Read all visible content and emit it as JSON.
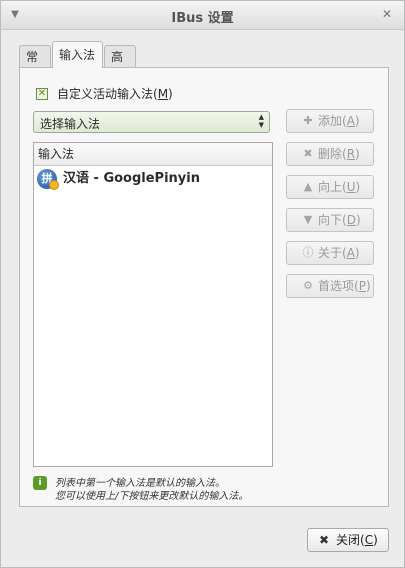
{
  "window": {
    "title": "IBus 设置",
    "menu_icon": "chevron-down-icon",
    "close_icon": "close-icon"
  },
  "tabs": [
    {
      "label": "常规",
      "active": false
    },
    {
      "label": "输入法",
      "active": true
    },
    {
      "label": "高级",
      "active": false
    }
  ],
  "custom_active": {
    "label_pre": "自定义活动输入法(",
    "mnemonic": "M",
    "label_post": ")",
    "checked": true
  },
  "selector": {
    "value": "选择输入法"
  },
  "engines": {
    "header": "输入法",
    "items": [
      {
        "name": "汉语 - GooglePinyin",
        "icon": "googlepinyin-icon"
      }
    ]
  },
  "side_buttons": [
    {
      "pre": "添加(",
      "mnemonic": "A",
      "post": ")",
      "icon": "plus-icon",
      "enabled": false
    },
    {
      "pre": "删除(",
      "mnemonic": "R",
      "post": ")",
      "icon": "remove-icon",
      "enabled": false
    },
    {
      "pre": "向上(",
      "mnemonic": "U",
      "post": ")",
      "icon": "arrow-up-icon",
      "enabled": false
    },
    {
      "pre": "向下(",
      "mnemonic": "D",
      "post": ")",
      "icon": "arrow-down-icon",
      "enabled": false
    },
    {
      "pre": "关于(",
      "mnemonic": "A",
      "post": ")",
      "icon": "info-icon",
      "enabled": false
    },
    {
      "pre": "首选项(",
      "mnemonic": "P",
      "post": ")",
      "icon": "preferences-icon",
      "enabled": false
    }
  ],
  "tip": {
    "line1": "列表中第一个输入法是默认的输入法。",
    "line2": "您可以使用上/下按钮来更改默认的输入法。",
    "icon": "info-icon"
  },
  "close_button": {
    "pre": "关闭(",
    "mnemonic": "C",
    "post": ")",
    "icon": "close-icon"
  },
  "colors": {
    "window_bg": "#ececec",
    "combo_green": "#dfe9d2",
    "info_green": "#5c9a2a"
  }
}
